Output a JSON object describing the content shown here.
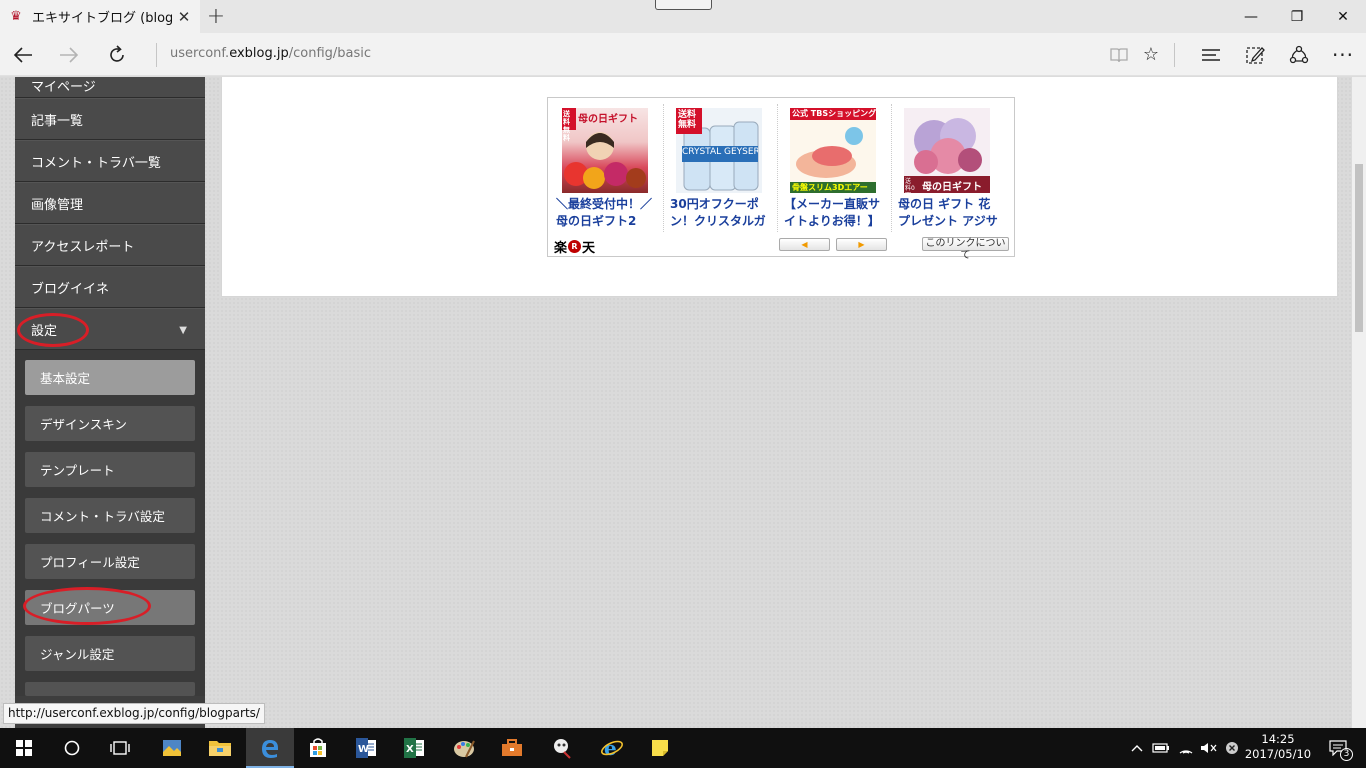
{
  "browser": {
    "tab_title": "エキサイトブログ (blog)",
    "tab_close": "✕",
    "new_tab": "+",
    "url_prefix": "userconf.",
    "url_domain": "exblog.jp",
    "url_path": "/config/basic"
  },
  "sidebar": {
    "items": [
      {
        "label": "マイページ"
      },
      {
        "label": "記事一覧"
      },
      {
        "label": "コメント・トラバ一覧"
      },
      {
        "label": "画像管理"
      },
      {
        "label": "アクセスレポート"
      },
      {
        "label": "ブログイイネ"
      },
      {
        "label": "設定"
      }
    ],
    "settings_caret": "▼",
    "submenu": [
      {
        "label": "基本設定"
      },
      {
        "label": "デザインスキン"
      },
      {
        "label": "テンプレート"
      },
      {
        "label": "コメント・トラバ設定"
      },
      {
        "label": "プロフィール設定"
      },
      {
        "label": "ブログパーツ"
      },
      {
        "label": "ジャンル設定"
      }
    ]
  },
  "ad": {
    "items": [
      {
        "caption": "＼最終受付中！／母の日ギフト2",
        "img_text": "母の日ギフト",
        "img_badge": "送料無料"
      },
      {
        "caption": "30円オフクーポン！クリスタルガ",
        "img_text": "CRYSTAL GEYSER",
        "img_badge": "送料無料"
      },
      {
        "caption": "【メーカー直販サイトよりお得！】",
        "img_text": "公式 TBSショッピング",
        "img_badge": "骨盤スリム3Dエアー"
      },
      {
        "caption": "母の日 ギフト 花 プレゼント アジサ",
        "img_text": "母の日ギフト",
        "img_badge": "送料0円"
      }
    ],
    "logo_left": "楽",
    "logo_r": "R",
    "logo_right": "天",
    "prev": "◀",
    "next": "▶",
    "about": "このリンクについて"
  },
  "status_url": "http://userconf.exblog.jp/config/blogparts/",
  "clock": {
    "time": "14:25",
    "date": "2017/05/10"
  },
  "notifications_count": "3",
  "colors": {
    "highlight_oval": "#d81e27",
    "sidebar_bg": "#3e3e3e",
    "active_sub_bg": "#9c9c9c",
    "ad_caption": "#1a3f9c"
  }
}
